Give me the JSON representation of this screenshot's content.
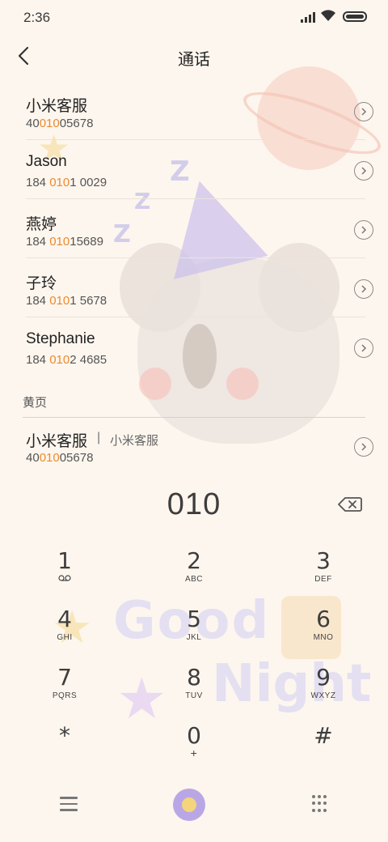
{
  "status_bar": {
    "time": "2:36"
  },
  "header": {
    "title": "通话"
  },
  "results": [
    {
      "name": "小米客服",
      "number_pre": "40",
      "number_match": "010",
      "number_post": "05678"
    },
    {
      "name": "Jason",
      "number_pre": "184 ",
      "number_match": "010",
      "number_post": "1 0029"
    },
    {
      "name": "燕婷",
      "number_pre": "184 ",
      "number_match": "010",
      "number_post": "15689"
    },
    {
      "name": "子玲",
      "number_pre": "184 ",
      "number_match": "010",
      "number_post": "1 5678"
    },
    {
      "name": "Stephanie",
      "number_pre": "184 ",
      "number_match": "010",
      "number_post": "2 4685"
    }
  ],
  "yellow_pages": {
    "section_label": "黄页",
    "name": "小米客服",
    "separator": "|",
    "subtitle": "小米客服",
    "number_pre": "40",
    "number_match": "010",
    "number_post": "05678"
  },
  "dial": {
    "digits": "010"
  },
  "keypad": [
    {
      "digit": "1",
      "letters": ""
    },
    {
      "digit": "2",
      "letters": "ABC"
    },
    {
      "digit": "3",
      "letters": "DEF"
    },
    {
      "digit": "4",
      "letters": "GHI"
    },
    {
      "digit": "5",
      "letters": "JKL"
    },
    {
      "digit": "6",
      "letters": "MNO"
    },
    {
      "digit": "7",
      "letters": "PQRS"
    },
    {
      "digit": "8",
      "letters": "TUV"
    },
    {
      "digit": "9",
      "letters": "WXYZ"
    },
    {
      "digit": "*",
      "letters": ""
    },
    {
      "digit": "0",
      "letters": "+"
    },
    {
      "digit": "#",
      "letters": ""
    }
  ],
  "background_art": {
    "goodnight_text_1": "Good",
    "goodnight_text_2": "Night"
  },
  "colors": {
    "match_highlight": "#ec8a2c",
    "background": "#fdf6ee",
    "call_button": "#b9a7e5"
  }
}
